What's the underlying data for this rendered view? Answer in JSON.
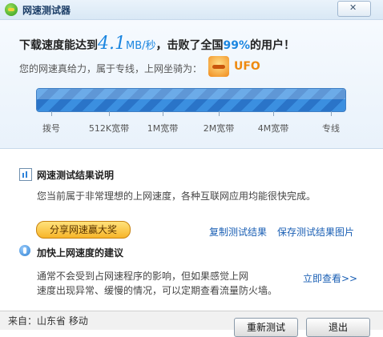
{
  "window": {
    "title": "网速测试器",
    "close_label": ""
  },
  "result": {
    "prefix": "下载速度能达到",
    "speed_value": "4.1",
    "speed_unit": "MB/秒",
    "mid": "，击败了全国",
    "percent": "99%",
    "suffix": "的用户！",
    "rank_text": "您的网速真给力，属于专线，上网坐骑为：",
    "rank_icon": "ufo-icon",
    "rank_name": "UFO"
  },
  "speed_bar": {
    "progress": 1.0,
    "fill_color": "#3b8fe0",
    "scale": [
      "拨号",
      "512K宽带",
      "1M宽带",
      "2M宽带",
      "4M宽带",
      "专线"
    ]
  },
  "explain": {
    "icon": "chart-icon",
    "title": "网速测试结果说明",
    "text": "您当前属于非常理想的上网速度，各种互联网应用均能很快完成。"
  },
  "actions": {
    "share": "分享网速赢大奖",
    "copy": "复制测试结果",
    "save_image": "保存测试结果图片"
  },
  "tips": {
    "icon": "info-icon",
    "title": "加快上网速度的建议",
    "line1": "通常不会受到占网速程序的影响，但如果感觉上网",
    "line2": "速度出现异常、缓慢的情况，可以定期查看流量防火墙。",
    "link": "立即查看>>"
  },
  "footer": {
    "source": "来自：山东省 移动",
    "retest": "重新测试",
    "exit": "退出"
  }
}
